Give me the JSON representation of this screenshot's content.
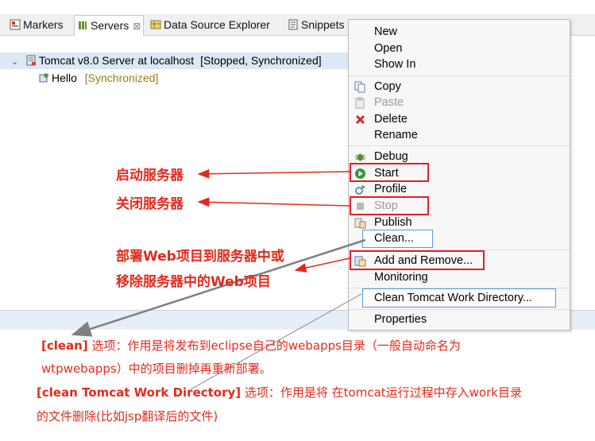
{
  "tabs": [
    {
      "label": "Markers",
      "icon": "markers-icon"
    },
    {
      "label": "Servers",
      "icon": "servers-icon",
      "close": "⊠"
    },
    {
      "label": "Data Source Explorer",
      "icon": "data-source-icon"
    },
    {
      "label": "Snippets",
      "icon": "snippets-icon"
    }
  ],
  "tree": {
    "server": {
      "name": "Tomcat v8.0 Server at localhost",
      "status": "[Stopped, Synchronized]"
    },
    "module": {
      "name": "Hello",
      "status": "[Synchronized]"
    }
  },
  "menu": {
    "new": "New",
    "open": "Open",
    "show_in": "Show In",
    "copy": "Copy",
    "paste": "Paste",
    "delete": "Delete",
    "rename": "Rename",
    "debug": "Debug",
    "start": "Start",
    "profile": "Profile",
    "stop": "Stop",
    "publish": "Publish",
    "clean": "Clean...",
    "add_remove": "Add and Remove...",
    "monitoring": "Monitoring",
    "clean_work_dir": "Clean Tomcat Work Directory...",
    "properties": "Properties"
  },
  "annotations": {
    "start_server": "启动服务器",
    "stop_server": "关闭服务器",
    "deploy_line1": "部署Web项目到服务器中或",
    "deploy_line2": "移除服务器中的Web项目"
  },
  "notes": {
    "clean_label": "[clean]",
    "clean_line1": " 选项：作用是将发布到eclipse自己的webapps目录（一般自动命名为",
    "clean_line2": "wtpwebapps）中的项目删掉再重新部署。",
    "cwd_label": "[clean Tomcat Work Directory]",
    "cwd_line1": " 选项：作用是将 在tomcat运行过程中存入work目录",
    "cwd_line2": "的文件删除(比如jsp翻译后的文件)"
  },
  "colors": {
    "annotation_red": "#e42a1c",
    "highlight_box_red": "#e0202a",
    "focus_box_blue": "#5a9bd8",
    "selection_bg": "#dbe8f6",
    "status_text": "#9a7a18"
  }
}
